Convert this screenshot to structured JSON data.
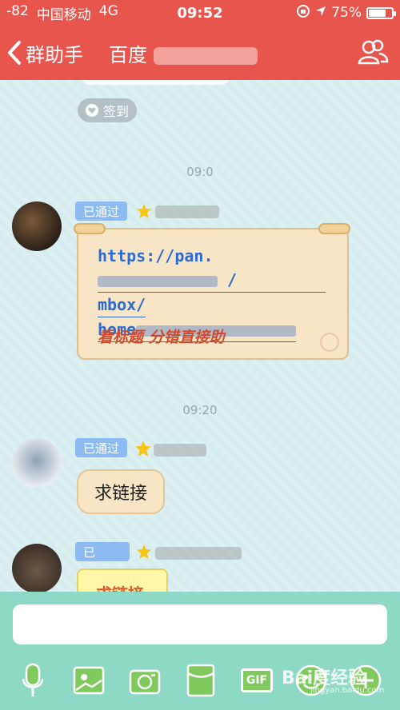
{
  "status": {
    "signal": "-82",
    "carrier": "中国移动",
    "network": "4G",
    "time": "09:52",
    "battery": "75%"
  },
  "header": {
    "back_label": "群助手",
    "title": "百度"
  },
  "chat": {
    "signin_label": "签到",
    "timestamps": [
      "09:0",
      "09:20"
    ],
    "messages": [
      {
        "badge": "已通过",
        "url_lines": [
          "https://pan.",
          "mbox/",
          "home"
        ],
        "note": "看标题 分错直接助"
      },
      {
        "badge": "已通过",
        "text": "求链接"
      },
      {
        "badge": "已",
        "sticker_text": "求链接"
      }
    ]
  },
  "toolbar": {
    "gif_label": "GIF"
  },
  "watermark": {
    "text": "Bai度经验",
    "sub": "jingyan.baidu.com"
  }
}
